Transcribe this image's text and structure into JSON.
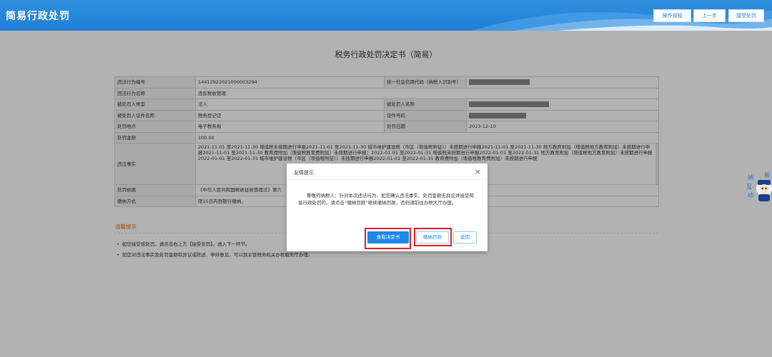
{
  "header": {
    "title": "简易行政处罚",
    "buttons": [
      "操作规程",
      "上一步",
      "接受处罚"
    ]
  },
  "doc_title": "税务行政处罚决定书（简易）",
  "table": {
    "row1": {
      "k1": "违法行为编号",
      "v1": "14412922021000003294",
      "k2": "统一社会信用代码（纳税人识别号）"
    },
    "row2": {
      "k1": "违法行为名称",
      "v1": "违反税收管理"
    },
    "row3": {
      "k1": "被处罚人类型",
      "v1": "法人",
      "k2": "被处罚人名称"
    },
    "row4": {
      "k1": "被处罚人证件名称",
      "v1": "税务登记证",
      "k2": "证件号码"
    },
    "row5": {
      "k1": "处罚地点",
      "v1": "电子税务局",
      "k2": "处罚日期",
      "v2": "2023-12-10"
    },
    "row6": {
      "k1": "处罚金额",
      "v1": "100.00"
    },
    "row7": {
      "k1": "违法事实",
      "v1": "2021-11-01 至2021-11-30 增值税未按期进行申报2021-11-01 至2021-11-30 城市维护建设税（市区（增值税附征））未按期进行申报2021-11-01 至2021-11-30 地方教育附加（增值税地方教育附加）未按期进行申报2021-11-01 至2021-11-30 教育费附加（增值税教育费附加）未按期进行申报；2022-01-01 至2022-01-31 增值税未按期进行申报2022-01-01 至2022-01-31 地方教育附加（增值税地方教育附加）未按期进行申报2022-01-01 至2022-01-31 城市维护建设税（市区（增值税附征））未按期进行申报2022-01-01 至2022-01-31 教育费附加（增值税教育费附加）未按期进行申报"
    },
    "row8": {
      "k1": "处罚依据",
      "v1": "《中华人民共和国税收征收管理法》第六"
    },
    "row9": {
      "k1": "缴纳方式",
      "v1": "限15日内到银行缴纳。"
    }
  },
  "tips": {
    "title": "温馨提示",
    "items": [
      "如您接受该处罚，请点击右上方【接受处罚】，进入下一环节。",
      "如您对违法事实及处罚金额有异议或陈述、申辩意见，可以到主管税务机关办税服务厅办理。"
    ]
  },
  "modal": {
    "title": "友情提示",
    "close": "×",
    "body": "尊敬的纳税人：针对本次违法行为，如您确认违法事实、处罚金额无异议并接受简易行政处罚的，请点击“缴纳罚款”继续缴纳罚款，否则请前往办税大厅办理。",
    "buttons": {
      "view": "查看决定书",
      "pay": "缴纳罚款",
      "back": "返回"
    }
  },
  "side_widget": {
    "text": [
      "纳",
      "互",
      "动",
      "税"
    ],
    "icon": "robot-icon"
  },
  "colors": {
    "header": "#1f7fd6",
    "primary": "#1e88e5",
    "highlight": "#e02020",
    "tips": "#e67e22"
  }
}
